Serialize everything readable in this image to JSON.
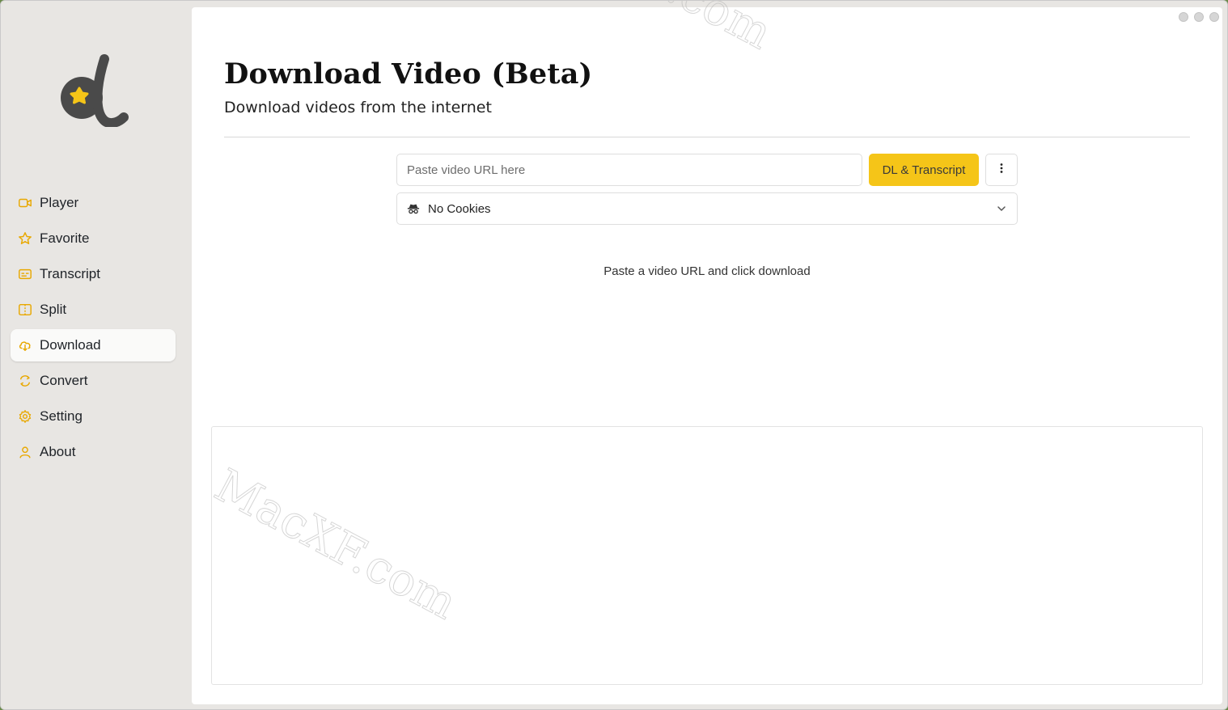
{
  "app": {
    "window_controls": [
      "minimize",
      "maximize",
      "close"
    ]
  },
  "sidebar": {
    "logo": "app-logo-d",
    "items": [
      {
        "label": "Player",
        "icon": "video-camera-icon",
        "active": false
      },
      {
        "label": "Favorite",
        "icon": "star-icon",
        "active": false
      },
      {
        "label": "Transcript",
        "icon": "subtitles-icon",
        "active": false
      },
      {
        "label": "Split",
        "icon": "split-icon",
        "active": false
      },
      {
        "label": "Download",
        "icon": "cloud-download-icon",
        "active": true
      },
      {
        "label": "Convert",
        "icon": "convert-icon",
        "active": false
      },
      {
        "label": "Setting",
        "icon": "gear-icon",
        "active": false
      },
      {
        "label": "About",
        "icon": "user-icon",
        "active": false
      }
    ]
  },
  "main": {
    "title": "Download Video (Beta)",
    "subtitle": "Download videos from the internet",
    "url_input": {
      "placeholder": "Paste video URL here",
      "value": ""
    },
    "download_button": "DL & Transcript",
    "more_button_icon": "more-vertical-icon",
    "cookie_select": {
      "icon": "spy-icon",
      "selected": "No Cookies"
    },
    "hint": "Paste a video URL and click download"
  },
  "watermark": {
    "text": "MacXF.com"
  },
  "colors": {
    "accent": "#f5c518",
    "sidebar_bg": "#e8e6e3",
    "icon_color": "#e8a800",
    "content_bg": "#ffffff"
  }
}
